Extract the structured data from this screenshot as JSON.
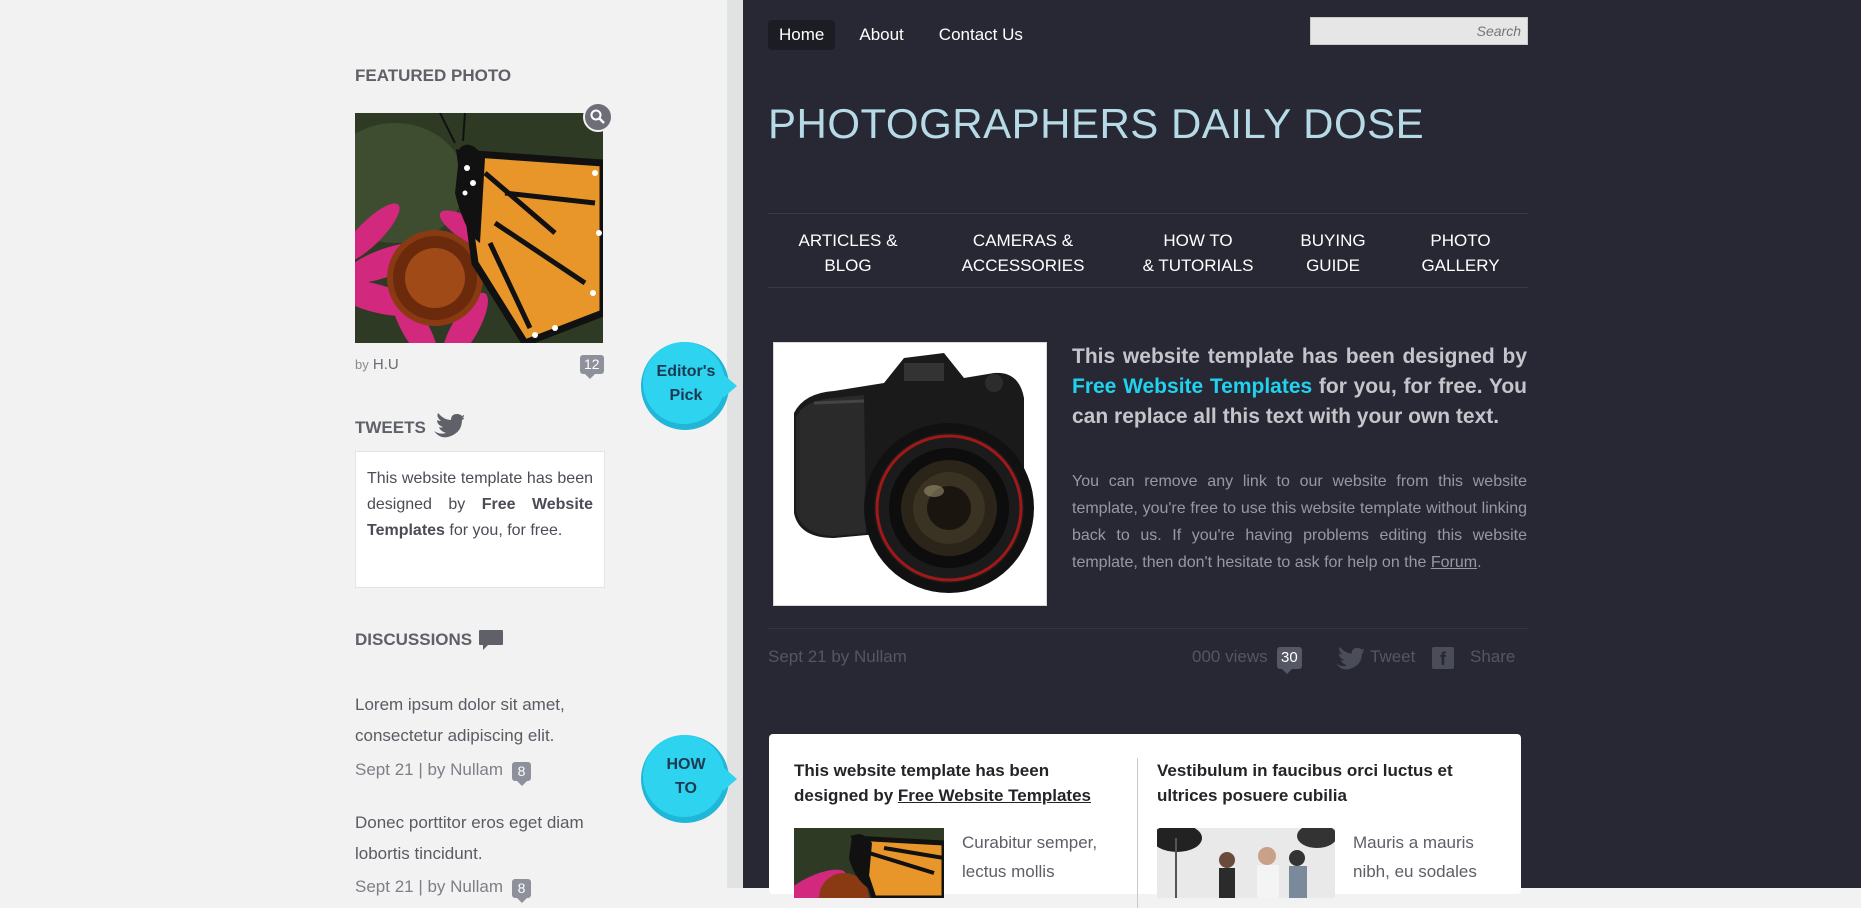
{
  "sidebar": {
    "featured_heading": "FEATURED PHOTO",
    "photo_by": "by",
    "photo_author": "H.U",
    "photo_comments": "12",
    "tweets_heading": "TWEETS",
    "tweet": {
      "text_before": "This website template has been designed by ",
      "link": "Free Website Templates",
      "text_after": " for you, for free."
    },
    "discussions_heading": "DISCUSSIONS",
    "discussions": [
      {
        "title": "Lorem ipsum dolor sit amet, consectetur adipiscing elit.",
        "meta": "Sept 21 | by Nullam",
        "count": "8"
      },
      {
        "title": "Donec porttitor eros eget diam lobortis tincidunt.",
        "meta": "Sept 21 | by Nullam",
        "count": "8"
      }
    ]
  },
  "topnav": {
    "items": [
      "Home",
      "About",
      "Contact Us"
    ],
    "active": "Home"
  },
  "search": {
    "placeholder": "Search"
  },
  "site_title": "PHOTOGRAPHERS DAILY DOSE",
  "categories": [
    {
      "line1": "ARTICLES &",
      "line2": "BLOG"
    },
    {
      "line1": "CAMERAS &",
      "line2": "ACCESSORIES"
    },
    {
      "line1": "HOW TO",
      "line2": "& TUTORIALS"
    },
    {
      "line1": "BUYING",
      "line2": "GUIDE"
    },
    {
      "line1": "PHOTO",
      "line2": "GALLERY"
    }
  ],
  "editors_pick": {
    "badge_line1": "Editor's",
    "badge_line2": "Pick",
    "headline_before": "This website template has been designed by ",
    "headline_link": "Free Website Templates",
    "headline_after": " for you, for free. You can replace all this text with your own text.",
    "body": "You can remove any link to our website from this website template, you're free to use this website template without linking back to us. If you're having problems editing this website template, then don't hesitate to ask for help on the ",
    "body_link": "Forum",
    "body_end": ".",
    "date": "Sept 21 by Nullam",
    "views": "000 views",
    "comments": "30",
    "tweet_label": "Tweet",
    "share_label": "Share",
    "fb_letter": "f"
  },
  "howto": {
    "badge_line1": "HOW",
    "badge_line2": "TO",
    "left_title_before": "This website template has been designed by ",
    "left_title_link": "Free Website Templates",
    "left_text": "Curabitur semper, lectus mollis",
    "right_title": "Vestibulum in faucibus orci luctus et ultrices posuere cubilia",
    "right_text": "Mauris a mauris nibh, eu sodales"
  },
  "colors": {
    "main_bg": "#272833",
    "sidebar_bg": "#f1f2f1",
    "accent": "#20d2ee",
    "title": "#b7dbe6"
  }
}
